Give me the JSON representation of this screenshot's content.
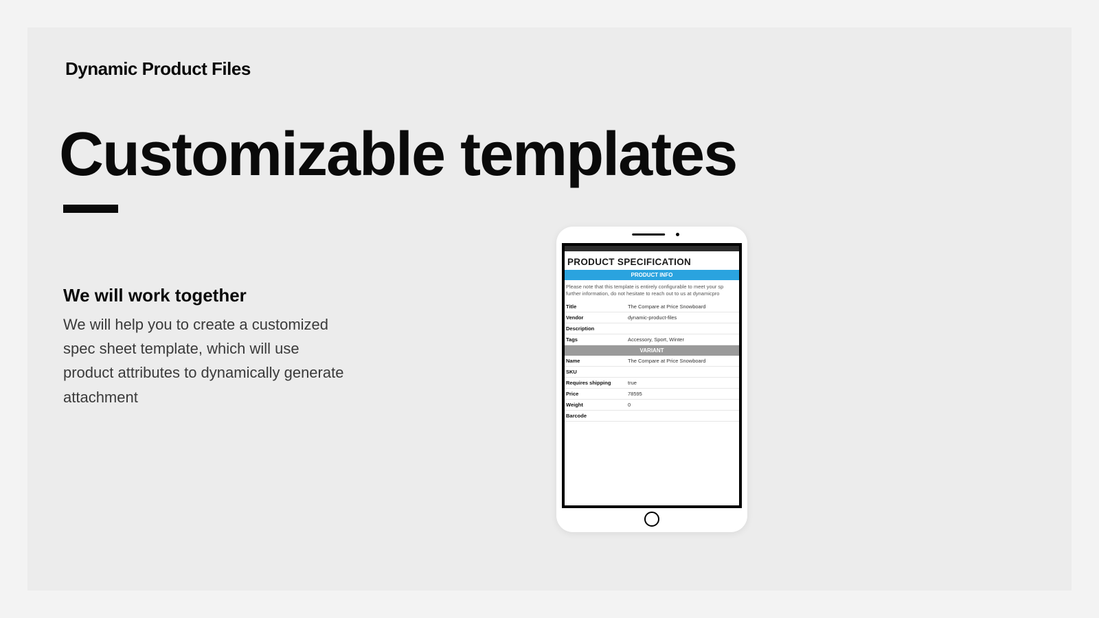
{
  "brand": "Dynamic Product Files",
  "title": "Customizable templates",
  "subtitle": "We will work together",
  "body": "We will help you to create a customized spec sheet template, which will use product attributes to dynamically generate attachment",
  "spec": {
    "heading": "PRODUCT SPECIFICATION",
    "section_info": "PRODUCT INFO",
    "section_variant": "VARIANT",
    "note": "Please note that this template is entirely configurable to meet your sp further information, do not hesitate to reach out to us at dynamicpro",
    "info_rows": [
      {
        "k": "Title",
        "v": "The Compare at Price Snowboard"
      },
      {
        "k": "Vendor",
        "v": "dynamic-product-files"
      },
      {
        "k": "Description",
        "v": ""
      },
      {
        "k": "Tags",
        "v": "Accessory, Sport, Winter"
      }
    ],
    "variant_rows": [
      {
        "k": "Name",
        "v": "The Compare at Price Snowboard"
      },
      {
        "k": "SKU",
        "v": ""
      },
      {
        "k": "Requires shipping",
        "v": "true"
      },
      {
        "k": "Price",
        "v": "78595"
      },
      {
        "k": "Weight",
        "v": "0"
      },
      {
        "k": "Barcode",
        "v": ""
      }
    ]
  }
}
